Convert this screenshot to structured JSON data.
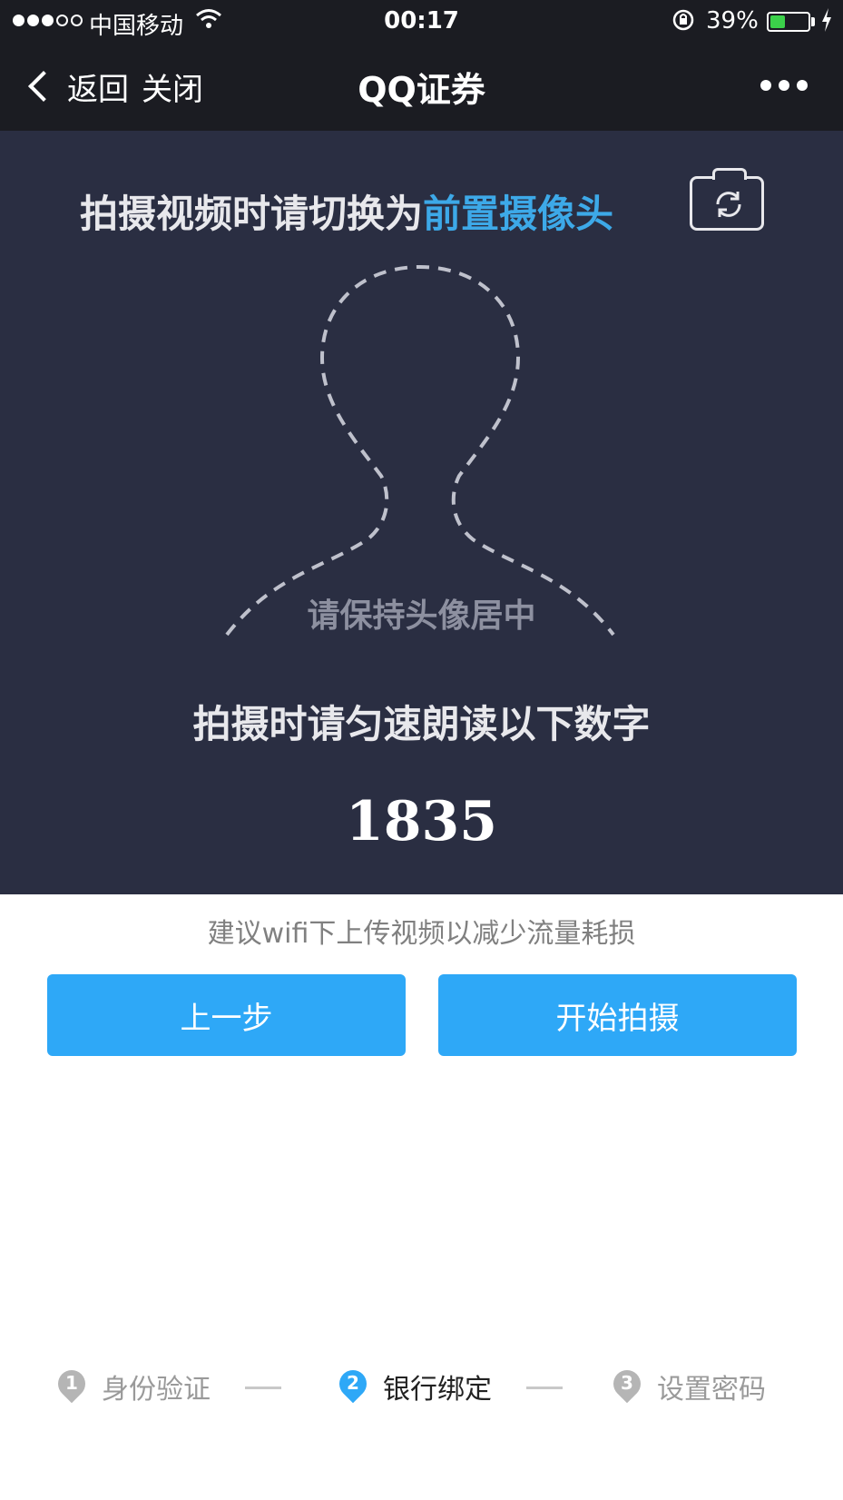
{
  "status_bar": {
    "carrier": "中国移动",
    "time": "00:17",
    "battery_percent": "39%",
    "battery_level": 0.39,
    "icons": [
      "signal-dots-icon",
      "wifi-icon",
      "rotation-lock-icon",
      "battery-icon",
      "charging-icon"
    ]
  },
  "nav": {
    "back_label": "返回",
    "close_label": "关闭",
    "title": "QQ证券",
    "more_icon": "more-dots-icon"
  },
  "camera": {
    "hint_prefix": "拍摄视频时请切换为",
    "hint_accent": "前置摄像头",
    "switch_icon": "switch-camera-icon",
    "center_hint": "请保持头像居中",
    "read_hint": "拍摄时请匀速朗读以下数字",
    "code": "1835"
  },
  "footer": {
    "wifi_tip": "建议wifi下上传视频以减少流量耗损",
    "prev_button": "上一步",
    "start_button": "开始拍摄"
  },
  "steps": [
    {
      "num": "1",
      "label": "身份验证",
      "active": false
    },
    {
      "num": "2",
      "label": "银行绑定",
      "active": true
    },
    {
      "num": "3",
      "label": "设置密码",
      "active": false
    }
  ],
  "colors": {
    "accent": "#2ea8f7",
    "hint_accent": "#3da9e8",
    "panel_bg": "#2a2e42",
    "bar_bg": "#1b1c22"
  }
}
